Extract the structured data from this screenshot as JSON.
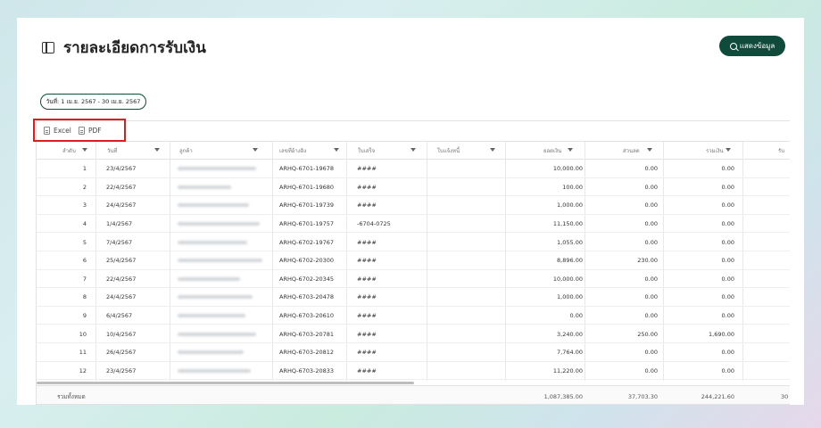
{
  "page": {
    "title": "รายละเอียดการรับเงิน",
    "show_button": "แสดงข้อมูล",
    "date_range": "วันที่: 1 เม.ย. 2567 - 30 เม.ย. 2567"
  },
  "toolbar": {
    "excel": "Excel",
    "pdf": "PDF"
  },
  "columns": [
    "ลำดับ",
    "วันที่",
    "ลูกค้า",
    "เลขที่อ้างอิง",
    "ใบเสร็จ",
    "ใบแจ้งหนี้",
    "ยอดเงิน",
    "ส่วนลด",
    "รวมเงิน",
    "รับ"
  ],
  "rows": [
    {
      "no": "1",
      "date": "23/4/2567",
      "ref": "ARHQ-6701-19678",
      "receipt": "####",
      "amount": "10,000.00",
      "discount": "0.00",
      "total": "0.00"
    },
    {
      "no": "2",
      "date": "22/4/2567",
      "ref": "ARHQ-6701-19680",
      "receipt": "####",
      "amount": "100.00",
      "discount": "0.00",
      "total": "0.00"
    },
    {
      "no": "3",
      "date": "24/4/2567",
      "ref": "ARHQ-6701-19739",
      "receipt": "####",
      "amount": "1,000.00",
      "discount": "0.00",
      "total": "0.00"
    },
    {
      "no": "4",
      "date": "1/4/2567",
      "ref": "ARHQ-6701-19757",
      "receipt": "-6704-0725",
      "amount": "11,150.00",
      "discount": "0.00",
      "total": "0.00"
    },
    {
      "no": "5",
      "date": "7/4/2567",
      "ref": "ARHQ-6702-19767",
      "receipt": "####",
      "amount": "1,055.00",
      "discount": "0.00",
      "total": "0.00"
    },
    {
      "no": "6",
      "date": "25/4/2567",
      "ref": "ARHQ-6702-20300",
      "receipt": "####",
      "amount": "8,896.00",
      "discount": "230.00",
      "total": "0.00"
    },
    {
      "no": "7",
      "date": "22/4/2567",
      "ref": "ARHQ-6702-20345",
      "receipt": "####",
      "amount": "10,000.00",
      "discount": "0.00",
      "total": "0.00"
    },
    {
      "no": "8",
      "date": "24/4/2567",
      "ref": "ARHQ-6703-20478",
      "receipt": "####",
      "amount": "1,000.00",
      "discount": "0.00",
      "total": "0.00"
    },
    {
      "no": "9",
      "date": "6/4/2567",
      "ref": "ARHQ-6703-20610",
      "receipt": "####",
      "amount": "0.00",
      "discount": "0.00",
      "total": "0.00"
    },
    {
      "no": "10",
      "date": "10/4/2567",
      "ref": "ARHQ-6703-20781",
      "receipt": "####",
      "amount": "3,240.00",
      "discount": "250.00",
      "total": "1,690.00"
    },
    {
      "no": "11",
      "date": "26/4/2567",
      "ref": "ARHQ-6703-20812",
      "receipt": "####",
      "amount": "7,764.00",
      "discount": "0.00",
      "total": "0.00"
    },
    {
      "no": "12",
      "date": "23/4/2567",
      "ref": "ARHQ-6703-20833",
      "receipt": "####",
      "amount": "11,220.00",
      "discount": "0.00",
      "total": "0.00"
    }
  ],
  "footer": {
    "label": "รวมทั้งหมด",
    "amount": "1,087,385.00",
    "discount": "37,703.30",
    "total": "244,221.60",
    "extra": "30"
  },
  "colors": {
    "brand": "#0f4a3a",
    "highlight": "#e01b1b"
  }
}
